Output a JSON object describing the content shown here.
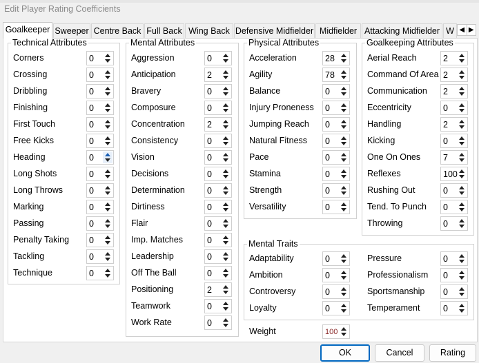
{
  "window": {
    "title": "Edit Player Rating Coefficients"
  },
  "tabs": [
    "Goalkeeper",
    "Sweeper",
    "Centre Back",
    "Full Back",
    "Wing Back",
    "Defensive Midfielder",
    "Midfielder",
    "Attacking Midfielder",
    "W"
  ],
  "tab_scroll": {
    "left": "◀",
    "right": "▶"
  },
  "groups": {
    "technical": {
      "title": "Technical Attributes",
      "rows": [
        {
          "label": "Corners",
          "value": "0"
        },
        {
          "label": "Crossing",
          "value": "0"
        },
        {
          "label": "Dribbling",
          "value": "0"
        },
        {
          "label": "Finishing",
          "value": "0"
        },
        {
          "label": "First Touch",
          "value": "0"
        },
        {
          "label": "Free Kicks",
          "value": "0"
        },
        {
          "label": "Heading",
          "value": "0"
        },
        {
          "label": "Long Shots",
          "value": "0"
        },
        {
          "label": "Long Throws",
          "value": "0"
        },
        {
          "label": "Marking",
          "value": "0"
        },
        {
          "label": "Passing",
          "value": "0"
        },
        {
          "label": "Penalty Taking",
          "value": "0"
        },
        {
          "label": "Tackling",
          "value": "0"
        },
        {
          "label": "Technique",
          "value": "0"
        }
      ]
    },
    "mental": {
      "title": "Mental Attributes",
      "rows": [
        {
          "label": "Aggression",
          "value": "0"
        },
        {
          "label": "Anticipation",
          "value": "2"
        },
        {
          "label": "Bravery",
          "value": "0"
        },
        {
          "label": "Composure",
          "value": "0"
        },
        {
          "label": "Concentration",
          "value": "2"
        },
        {
          "label": "Consistency",
          "value": "0"
        },
        {
          "label": "Vision",
          "value": "0"
        },
        {
          "label": "Decisions",
          "value": "0"
        },
        {
          "label": "Determination",
          "value": "0"
        },
        {
          "label": "Dirtiness",
          "value": "0"
        },
        {
          "label": "Flair",
          "value": "0"
        },
        {
          "label": "Imp. Matches",
          "value": "0"
        },
        {
          "label": "Leadership",
          "value": "0"
        },
        {
          "label": "Off The Ball",
          "value": "0"
        },
        {
          "label": "Positioning",
          "value": "2"
        },
        {
          "label": "Teamwork",
          "value": "0"
        },
        {
          "label": "Work Rate",
          "value": "0"
        }
      ]
    },
    "physical": {
      "title": "Physical Attributes",
      "rows": [
        {
          "label": "Acceleration",
          "value": "28"
        },
        {
          "label": "Agility",
          "value": "78"
        },
        {
          "label": "Balance",
          "value": "0"
        },
        {
          "label": "Injury Proneness",
          "value": "0"
        },
        {
          "label": "Jumping Reach",
          "value": "0"
        },
        {
          "label": "Natural Fitness",
          "value": "0"
        },
        {
          "label": "Pace",
          "value": "0"
        },
        {
          "label": "Stamina",
          "value": "0"
        },
        {
          "label": "Strength",
          "value": "0"
        },
        {
          "label": "Versatility",
          "value": "0"
        }
      ]
    },
    "goalkeeping": {
      "title": "Goalkeeping Attributes",
      "rows": [
        {
          "label": "Aerial Reach",
          "value": "2"
        },
        {
          "label": "Command Of Area",
          "value": "2"
        },
        {
          "label": "Communication",
          "value": "2"
        },
        {
          "label": "Eccentricity",
          "value": "0"
        },
        {
          "label": "Handling",
          "value": "2"
        },
        {
          "label": "Kicking",
          "value": "0"
        },
        {
          "label": "One On Ones",
          "value": "7"
        },
        {
          "label": "Reflexes",
          "value": "100"
        },
        {
          "label": "Rushing Out",
          "value": "0"
        },
        {
          "label": "Tend. To Punch",
          "value": "0"
        },
        {
          "label": "Throwing",
          "value": "0"
        }
      ]
    },
    "traits": {
      "title": "Mental Traits",
      "left": [
        {
          "label": "Adaptability",
          "value": "0"
        },
        {
          "label": "Ambition",
          "value": "0"
        },
        {
          "label": "Controversy",
          "value": "0"
        },
        {
          "label": "Loyalty",
          "value": "0"
        }
      ],
      "right": [
        {
          "label": "Pressure",
          "value": "0"
        },
        {
          "label": "Professionalism",
          "value": "0"
        },
        {
          "label": "Sportsmanship",
          "value": "0"
        },
        {
          "label": "Temperament",
          "value": "0"
        }
      ]
    }
  },
  "weight": {
    "label": "Weight",
    "value": "100"
  },
  "buttons": {
    "ok": "OK",
    "cancel": "Cancel",
    "rating": "Rating"
  },
  "colors": {
    "accent": "#0067c0",
    "weight_value": "#8b2a2a"
  }
}
